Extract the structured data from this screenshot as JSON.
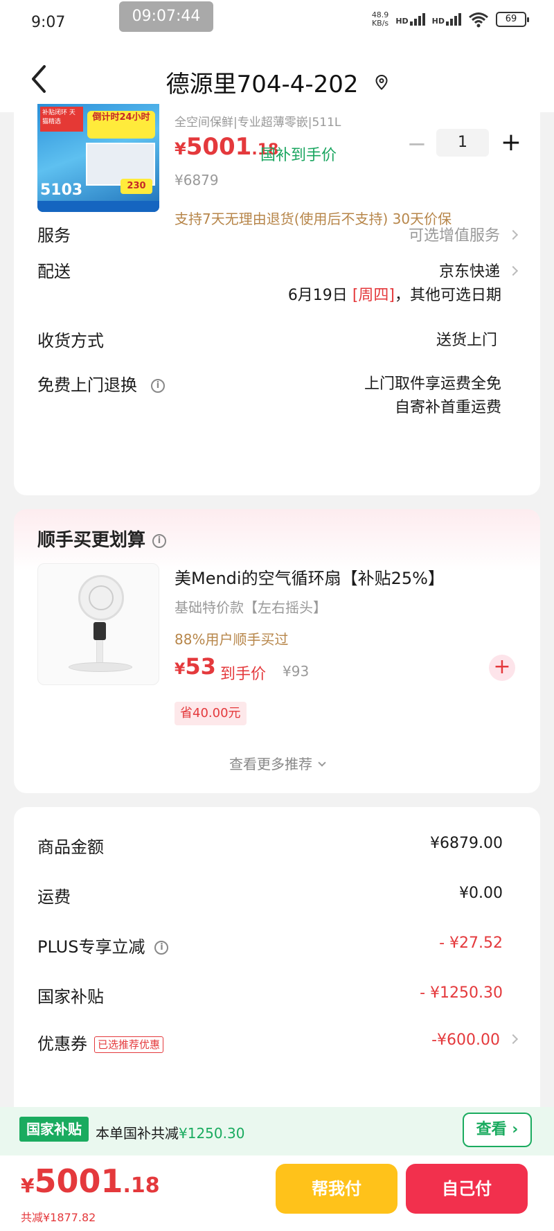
{
  "status_bar": {
    "time": "9:07",
    "clock_overlay": "09:07:44",
    "net_speed_value": "48.9",
    "net_speed_unit": "KB/s",
    "signal_1": "HD",
    "signal_2": "HD",
    "battery": "69",
    "icons": [
      "signal-icon",
      "wifi-icon",
      "battery-icon"
    ]
  },
  "header": {
    "title": "德源里704-4-202",
    "icons": [
      "back-arrow-icon",
      "location-pin-icon"
    ]
  },
  "product": {
    "subtitle": "全空间保鲜|专业超薄零嵌|511L",
    "price_currency": "¥",
    "price_int": "5001",
    "price_dec": ".18",
    "price_tag": "国补到手价",
    "original_price": "¥6879",
    "quantity": "1",
    "minus_label": "−",
    "plus_label": "+",
    "return_note": "支持7天无理由退货(使用后不支持) 30天价保",
    "image_texts": {
      "tag1": "补贴闭环 天猫精选",
      "tag2": "倒计时24小时",
      "big": "5103",
      "amount": "230"
    }
  },
  "rows": {
    "service_label": "服务",
    "service_value": "可选增值服务",
    "delivery_label": "配送",
    "delivery_value": "京东快递",
    "delivery_date_prefix": "6月19日 ",
    "delivery_date_day": "[周四]",
    "delivery_date_suffix": "，其他可选日期",
    "receive_label": "收货方式",
    "receive_value": "送货上门",
    "return_label": "免费上门退换",
    "return_value_1": "上门取件享运费全免",
    "return_value_2": "自寄补首重运费"
  },
  "recommend": {
    "title": "顺手买更划算",
    "name": "美Mendi的空气循环扇【补贴25%】",
    "variant": "基础特价款【左右摇头】",
    "buyers": "88%用户顺手买过",
    "price_currency": "¥",
    "price_int": "53",
    "price_tag": "到手价",
    "original_price": "¥93",
    "save": "省40.00元",
    "add_label": "+",
    "more": "查看更多推荐"
  },
  "summary": {
    "goods_label": "商品金额",
    "goods_value": "¥6879.00",
    "shipping_label": "运费",
    "shipping_value": "¥0.00",
    "plus_label": "PLUS专享立减",
    "plus_value": "- ¥27.52",
    "subsidy_label": "国家补贴",
    "subsidy_value": "- ¥1250.30",
    "coupon_label": "优惠券",
    "coupon_badge": "已选推荐优惠",
    "coupon_value": "-¥600.00"
  },
  "subsidy_bar": {
    "badge": "国家补贴",
    "text": "本单国补共减",
    "amount": "¥1250.30",
    "view_label": "查看 ›"
  },
  "footer": {
    "total_currency": "¥",
    "total_int": "5001",
    "total_dec": ".18",
    "saved": "共减¥1877.82",
    "help_pay": "帮我付",
    "self_pay": "自己付"
  },
  "colors": {
    "accent_red": "#e4393c",
    "subsidy_green": "#1aab5f",
    "help_button_yellow": "#ffc21a",
    "pay_button_red": "#f2304d"
  }
}
